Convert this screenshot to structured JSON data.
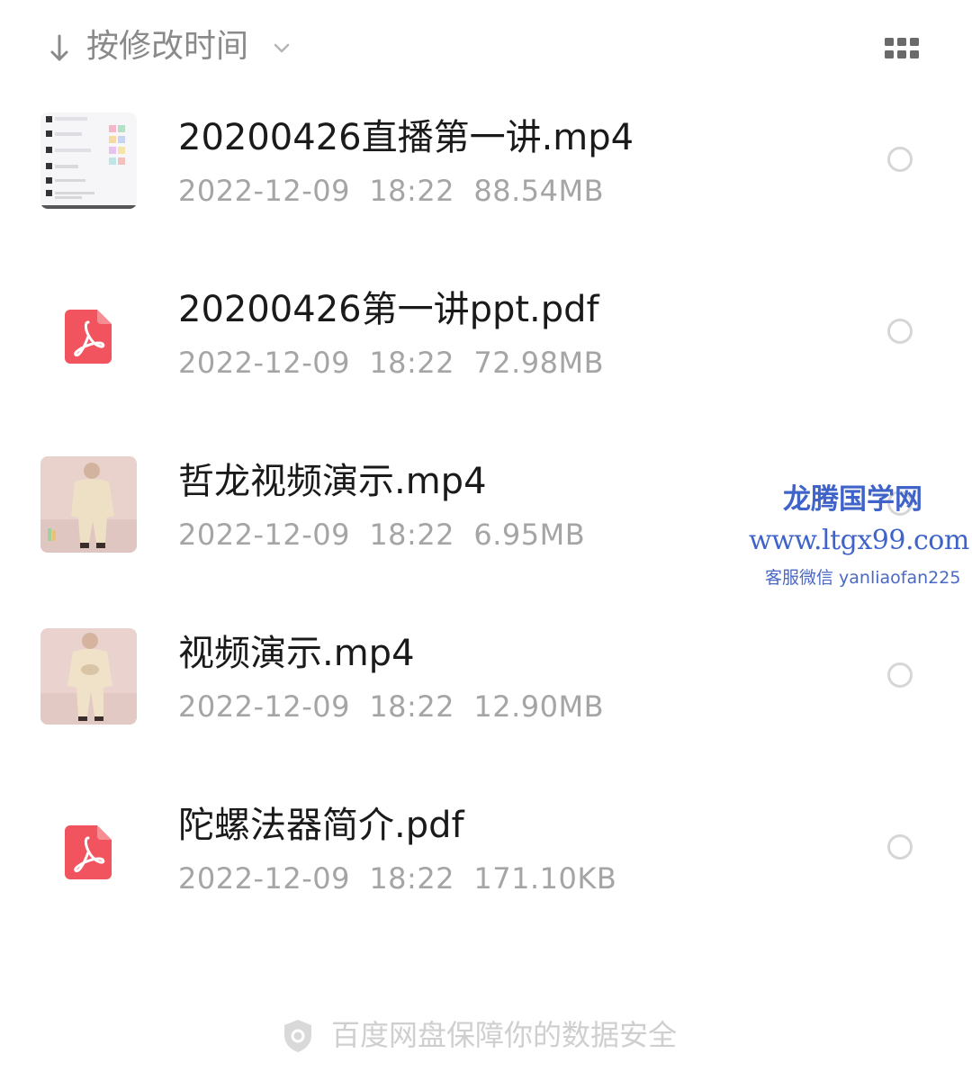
{
  "toolbar": {
    "sort_label": "按修改时间",
    "sort_icon": "arrow-down-icon",
    "dropdown_icon": "chevron-down-icon",
    "view_toggle_icon": "grid-view-icon"
  },
  "files": [
    {
      "name": "20200426直播第一讲.mp4",
      "date": "2022-12-09",
      "time": "18:22",
      "size": "88.54MB",
      "icon": "chat-screenshot-thumbnail"
    },
    {
      "name": "20200426第一讲ppt.pdf",
      "date": "2022-12-09",
      "time": "18:22",
      "size": "72.98MB",
      "icon": "pdf-icon"
    },
    {
      "name": "哲龙视频演示.mp4",
      "date": "2022-12-09",
      "time": "18:22",
      "size": "6.95MB",
      "icon": "video-thumbnail"
    },
    {
      "name": "视频演示.mp4",
      "date": "2022-12-09",
      "time": "18:22",
      "size": "12.90MB",
      "icon": "video-thumbnail"
    },
    {
      "name": "陀螺法器简介.pdf",
      "date": "2022-12-09",
      "time": "18:22",
      "size": "171.10KB",
      "icon": "pdf-icon"
    }
  ],
  "watermark": {
    "title": "龙腾国学网",
    "url": "www.ltgx99.com",
    "contact": "客服微信 yanliaofan225"
  },
  "footer": {
    "text": "百度网盘保障你的数据安全",
    "icon": "shield-icon"
  },
  "colors": {
    "pdf_red": "#f1545e",
    "meta_gray": "#a5a5a5",
    "watermark_blue": "#3f63c9"
  }
}
